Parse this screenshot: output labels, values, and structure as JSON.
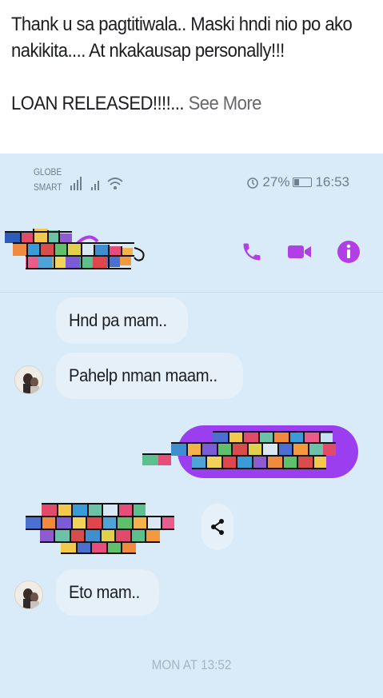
{
  "post": {
    "line1": "Thank u sa pagtitiwala.. Maski hndi nio po ako",
    "line2": "nakikita.... At nkakausap personally!!!",
    "line3": "LOAN RELEASED!!!!...",
    "see_more": "See More"
  },
  "status_bar": {
    "carrier1": "GLOBE",
    "carrier2": "SMART",
    "battery_pct": "27%",
    "time": "16:53"
  },
  "header": {
    "icons": [
      "phone-icon",
      "video-icon",
      "info-icon"
    ],
    "accent": "#b23ee6"
  },
  "messages": [
    {
      "text": "Hnd pa mam.."
    },
    {
      "text": "Pahelp nman maam.."
    },
    {
      "text": "Eto mam.."
    }
  ],
  "timestamp": "MON AT 13:52",
  "colors": {
    "chat_bg": "#d9ebf8",
    "bubble_bg": "#e6f0f8",
    "sent_bubble": "#9a3ef0"
  }
}
